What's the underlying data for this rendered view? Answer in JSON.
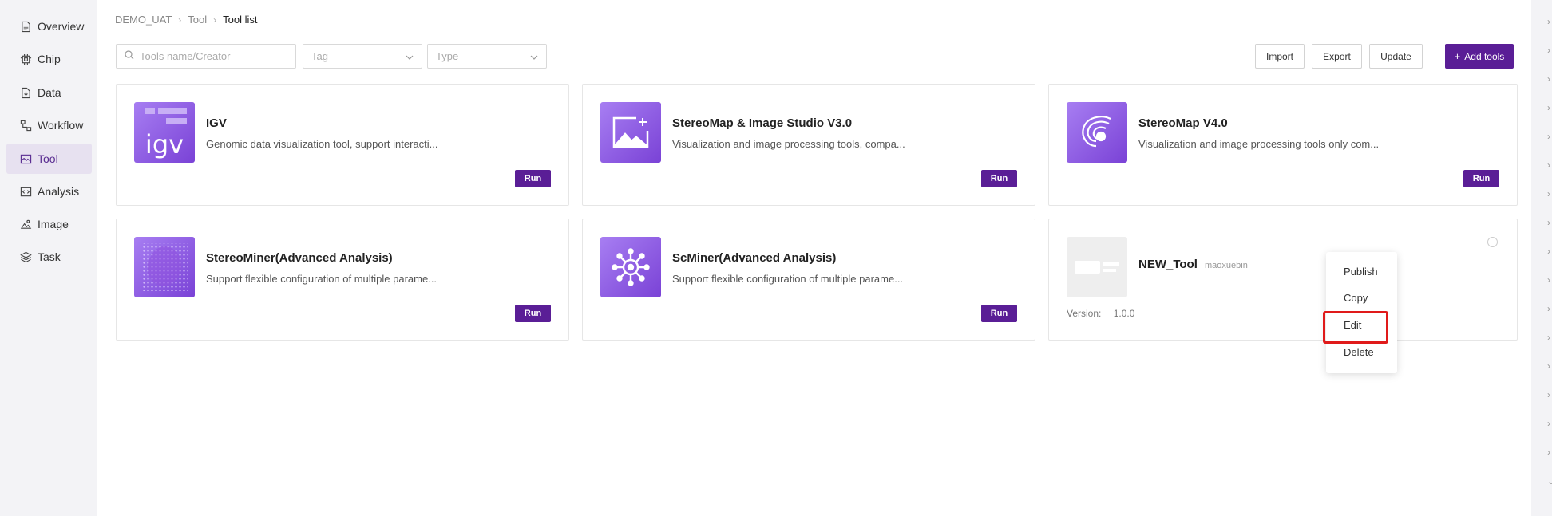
{
  "sidebar": {
    "items": [
      {
        "label": "Overview",
        "icon": "document-icon"
      },
      {
        "label": "Chip",
        "icon": "chip-icon"
      },
      {
        "label": "Data",
        "icon": "data-icon"
      },
      {
        "label": "Workflow",
        "icon": "workflow-icon"
      },
      {
        "label": "Tool",
        "icon": "tool-icon",
        "active": true
      },
      {
        "label": "Analysis",
        "icon": "analysis-icon"
      },
      {
        "label": "Image",
        "icon": "image-icon"
      },
      {
        "label": "Task",
        "icon": "layers-icon"
      }
    ]
  },
  "breadcrumb": [
    "DEMO_UAT",
    "Tool",
    "Tool list"
  ],
  "filters": {
    "search_placeholder": "Tools name/Creator",
    "tag_placeholder": "Tag",
    "type_placeholder": "Type"
  },
  "toolbar": {
    "import_label": "Import",
    "export_label": "Export",
    "update_label": "Update",
    "add_label": "Add tools"
  },
  "cards": [
    {
      "name": "IGV",
      "desc": "Genomic data visualization tool, support interacti...",
      "run_label": "Run",
      "logo_text": "igv"
    },
    {
      "name": "StereoMap & Image Studio V3.0",
      "desc": "Visualization and image processing tools, compa...",
      "run_label": "Run"
    },
    {
      "name": "StereoMap V4.0",
      "desc": "Visualization and image processing tools only com...",
      "run_label": "Run"
    },
    {
      "name": "StereoMiner(Advanced Analysis)",
      "desc": "Support flexible configuration of multiple parame...",
      "run_label": "Run"
    },
    {
      "name": "ScMiner(Advanced Analysis)",
      "desc": "Support flexible configuration of multiple parame...",
      "run_label": "Run"
    },
    {
      "name": "NEW_Tool",
      "creator": "maoxuebin",
      "version_label": "Version:",
      "version_value": "1.0.0"
    }
  ],
  "menu": {
    "items": [
      "Publish",
      "Copy",
      "Edit",
      "Delete"
    ],
    "highlighted": "Edit"
  },
  "colors": {
    "accent": "#5a1e96",
    "active_bg": "#e7e1f0",
    "highlight_border": "#e01a1a"
  }
}
